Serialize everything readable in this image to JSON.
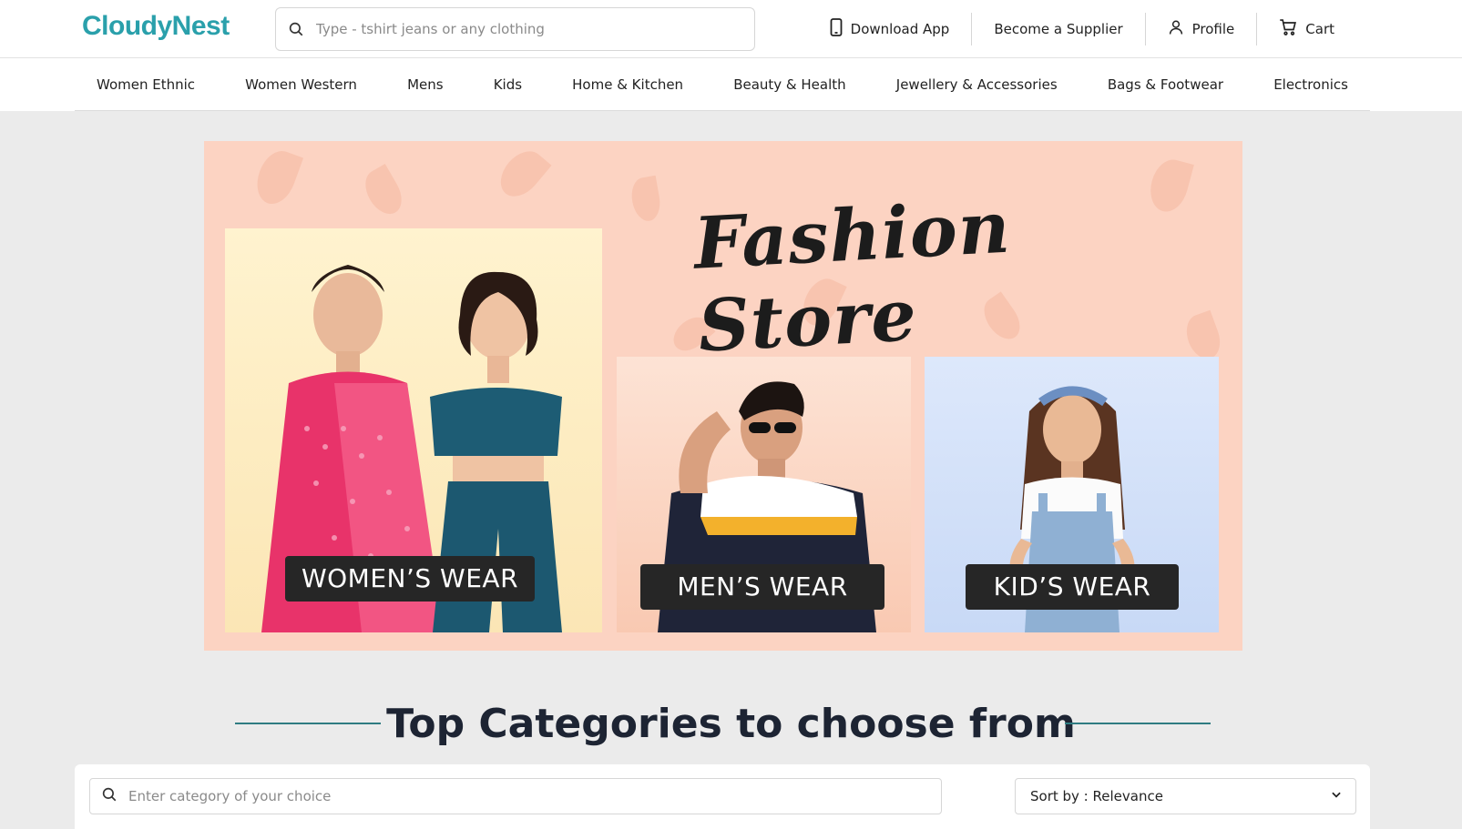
{
  "header": {
    "logo": "CloudyNest",
    "search_placeholder": "Type - tshirt jeans or any clothing",
    "links": {
      "download_app": "Download App",
      "become_supplier": "Become a Supplier",
      "profile": "Profile",
      "cart": "Cart"
    }
  },
  "nav": {
    "items": [
      "Women Ethnic",
      "Women Western",
      "Mens",
      "Kids",
      "Home & Kitchen",
      "Beauty & Health",
      "Jewellery & Accessories",
      "Bags & Footwear",
      "Electronics"
    ]
  },
  "banner": {
    "title": "Fashion Store",
    "womens_label": "WOMEN’S WEAR",
    "mens_label": "MEN’S WEAR",
    "kids_label": "KID’S WEAR"
  },
  "section": {
    "title": "Top Categories to choose from"
  },
  "filters": {
    "category_placeholder": "Enter category of your choice",
    "sort_label": "Sort by : Relevance"
  },
  "colors": {
    "brand": "#2aa0ab",
    "banner_bg": "#fcd3c2",
    "title_text": "#1d2433"
  }
}
